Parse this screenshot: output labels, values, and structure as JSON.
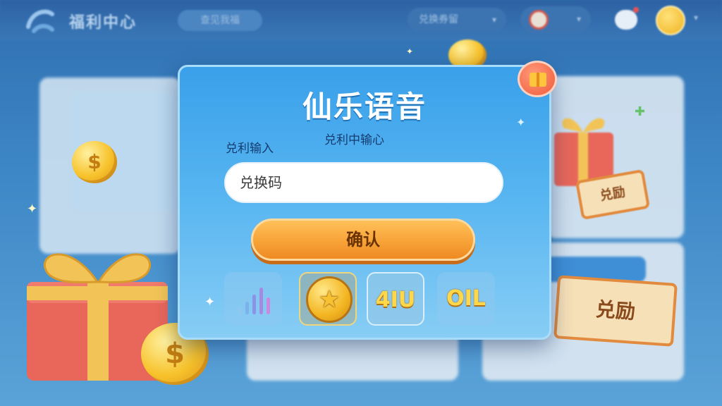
{
  "topbar": {
    "app_title": "福利中心",
    "search_placeholder": "查见我福",
    "dropdown_label": "兑换券留",
    "logo_icon": "brand-logo-icon",
    "chat_icon": "chat-bubble-icon",
    "clock_icon": "alarm-clock-icon",
    "avatar_icon": "user-avatar-icon"
  },
  "modal": {
    "title": "仙乐语音",
    "subtitle": "兑利中输心",
    "field_label": "兑利输入",
    "input_placeholder": "兑换码",
    "input_value": "",
    "confirm_label": "确认",
    "gift_icon": "gift-icon",
    "tiles": [
      {
        "name": "signal-bars-icon"
      },
      {
        "name": "star-coin-icon"
      },
      {
        "name": "badge-text",
        "label": "4IU"
      },
      {
        "name": "badge-text",
        "label": "OIL"
      }
    ]
  },
  "decor": {
    "ticket_big": "兑励",
    "ticket_small": "兑励"
  },
  "colors": {
    "accent_blue": "#3aa0ea",
    "confirm_orange": "#f7a338",
    "gold": "#f7c22b"
  }
}
